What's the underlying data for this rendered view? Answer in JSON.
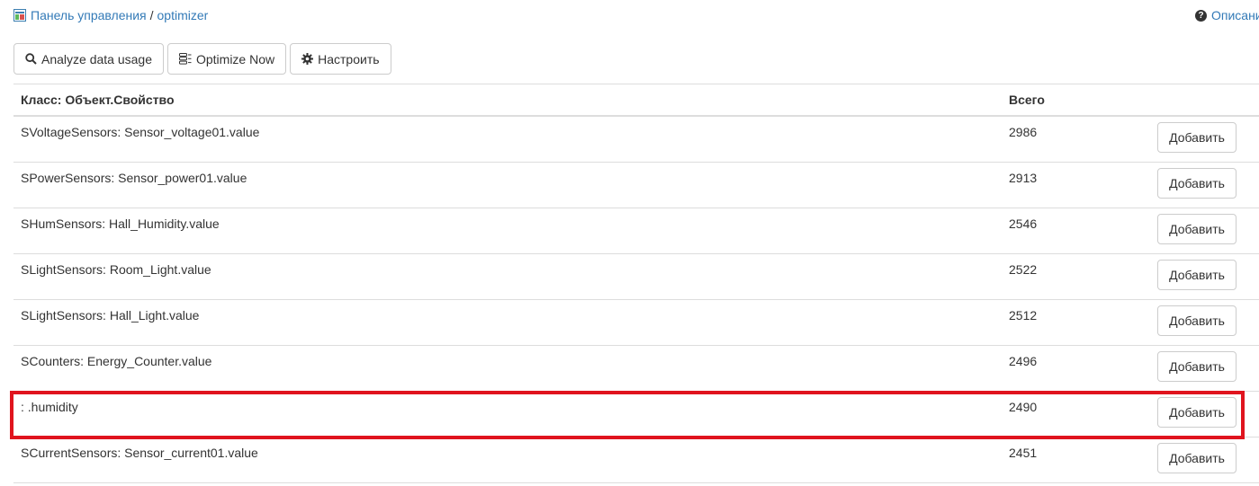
{
  "breadcrumb": {
    "root": "Панель управления",
    "separator": "/",
    "current": "optimizer"
  },
  "help": {
    "label": "Описани"
  },
  "toolbar": {
    "analyze_label": "Analyze data usage",
    "optimize_label": "Optimize Now",
    "settings_label": "Настроить"
  },
  "table": {
    "headers": {
      "name": "Класс: Объект.Свойство",
      "total": "Всего"
    },
    "add_label": "Добавить",
    "rows": [
      {
        "name": "SVoltageSensors: Sensor_voltage01.value",
        "total": "2986"
      },
      {
        "name": "SPowerSensors: Sensor_power01.value",
        "total": "2913"
      },
      {
        "name": "SHumSensors: Hall_Humidity.value",
        "total": "2546"
      },
      {
        "name": "SLightSensors: Room_Light.value",
        "total": "2522"
      },
      {
        "name": "SLightSensors: Hall_Light.value",
        "total": "2512"
      },
      {
        "name": "SCounters: Energy_Counter.value",
        "total": "2496"
      },
      {
        "name": ": .humidity",
        "total": "2490"
      },
      {
        "name": "SCurrentSensors: Sensor_current01.value",
        "total": "2451"
      }
    ]
  },
  "colors": {
    "link": "#337ab7",
    "highlight": "#e0141e",
    "border": "#dddddd"
  },
  "icons": [
    "app-icon",
    "question-icon",
    "search-icon",
    "database-icon",
    "gear-icon"
  ]
}
